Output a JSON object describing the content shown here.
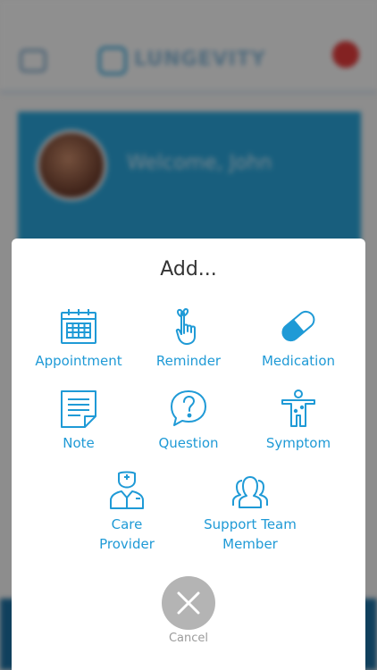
{
  "background": {
    "brand": "LUNGEVITY",
    "welcome": "Welcome, John"
  },
  "modal": {
    "title": "Add...",
    "items": [
      {
        "icon": "calendar-icon",
        "label": "Appointment"
      },
      {
        "icon": "finger-string-icon",
        "label": "Reminder"
      },
      {
        "icon": "pill-icon",
        "label": "Medication"
      },
      {
        "icon": "note-icon",
        "label": "Note"
      },
      {
        "icon": "question-bubble-icon",
        "label": "Question"
      },
      {
        "icon": "body-figure-icon",
        "label": "Symptom"
      },
      {
        "icon": "doctor-icon",
        "label": "Care Provider"
      },
      {
        "icon": "team-icon",
        "label": "Support Team Member"
      }
    ],
    "cancel_label": "Cancel"
  },
  "colors": {
    "accent": "#1f9ad6",
    "overlay": "#000000",
    "cancel_button": "#b4b4b4"
  }
}
